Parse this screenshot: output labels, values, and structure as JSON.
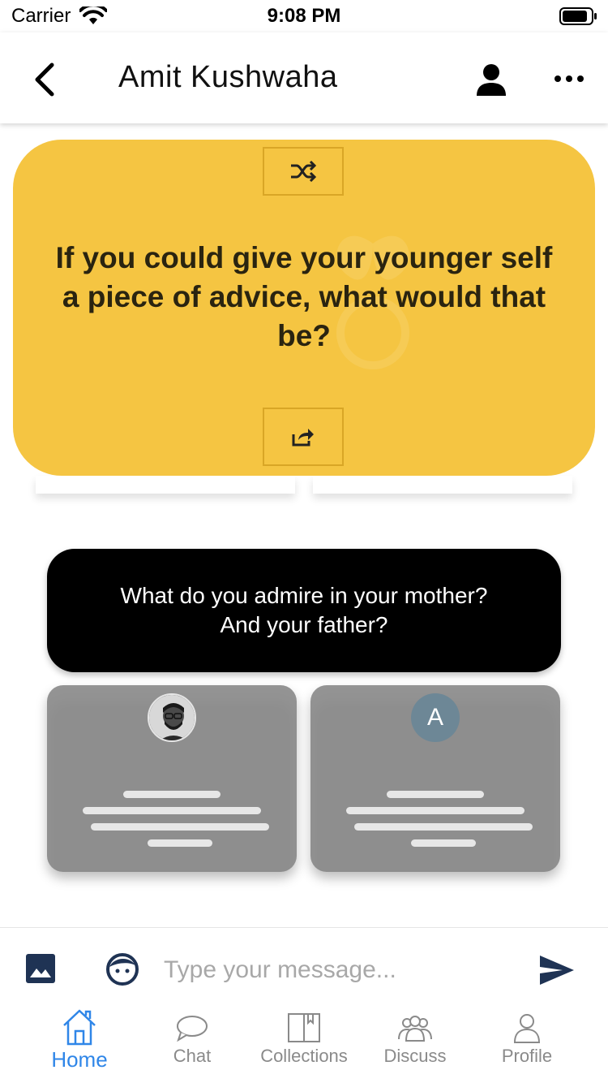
{
  "status": {
    "carrier": "Carrier",
    "time": "9:08 PM"
  },
  "header": {
    "title": "Amit Kushwaha"
  },
  "prompt_card": {
    "text": "If you could give your younger self a piece of advice, what would that be?",
    "background": "#f5c542"
  },
  "question_card": {
    "line1": "What do you admire in your mother?",
    "line2": "And your father?"
  },
  "answers": [
    {
      "avatar_type": "photo"
    },
    {
      "avatar_type": "letter",
      "avatar_letter": "A"
    }
  ],
  "message_bar": {
    "placeholder": "Type your message..."
  },
  "tabs": [
    {
      "label": "Home",
      "icon": "home-icon",
      "active": true
    },
    {
      "label": "Chat",
      "icon": "chat-icon",
      "active": false
    },
    {
      "label": "Collections",
      "icon": "book-icon",
      "active": false
    },
    {
      "label": "Discuss",
      "icon": "group-icon",
      "active": false
    },
    {
      "label": "Profile",
      "icon": "profile-icon",
      "active": false
    }
  ],
  "colors": {
    "accent": "#2f86e8",
    "nav_icon": "#1f3354"
  }
}
